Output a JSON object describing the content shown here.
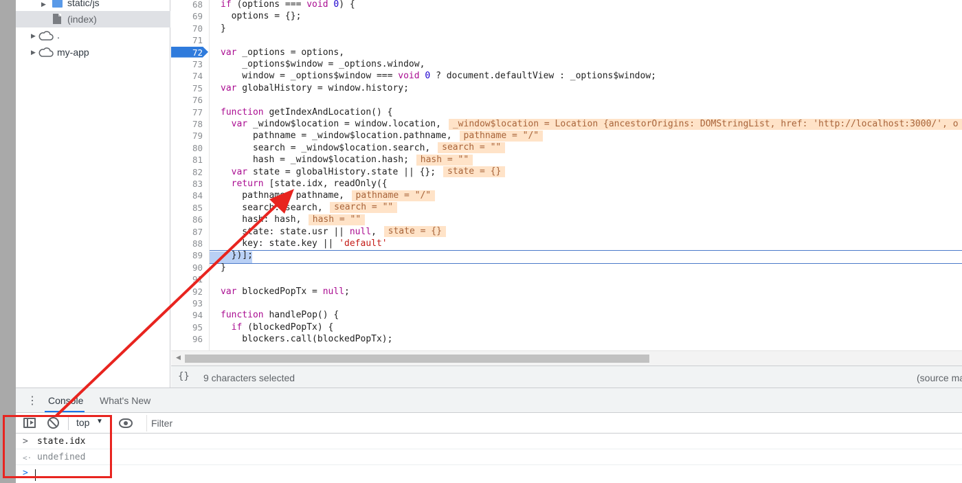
{
  "sidebar": {
    "items": [
      {
        "label": "static/js",
        "type": "folder"
      },
      {
        "label": "(index)",
        "type": "file",
        "selected": true
      },
      {
        "label": ".",
        "type": "cloud"
      },
      {
        "label": "my-app",
        "type": "cloud"
      }
    ]
  },
  "editor": {
    "breakpoint_line": "72",
    "lines": [
      {
        "n": "68",
        "code": "  if (options === void 0) {"
      },
      {
        "n": "69",
        "code": "    options = {};"
      },
      {
        "n": "70",
        "code": "  }"
      },
      {
        "n": "71",
        "code": ""
      },
      {
        "n": "72",
        "code": "  var _options = options,"
      },
      {
        "n": "73",
        "code": "      _options$window = _options.window,"
      },
      {
        "n": "74",
        "code": "      window = _options$window === void 0 ? document.defaultView : _options$window;"
      },
      {
        "n": "75",
        "code": "  var globalHistory = window.history;"
      },
      {
        "n": "76",
        "code": ""
      },
      {
        "n": "77",
        "code": "  function getIndexAndLocation() {"
      },
      {
        "n": "78",
        "code": "    var _window$location = window.location,",
        "value": "_window$location = Location {ancestorOrigins: DOMStringList, href: 'http://localhost:3000/', o"
      },
      {
        "n": "79",
        "code": "        pathname = _window$location.pathname,",
        "value": "pathname = \"/\""
      },
      {
        "n": "80",
        "code": "        search = _window$location.search,",
        "value": "search = \"\""
      },
      {
        "n": "81",
        "code": "        hash = _window$location.hash;",
        "value": "hash = \"\""
      },
      {
        "n": "82",
        "code": "    var state = globalHistory.state || {};",
        "value": "state = {}"
      },
      {
        "n": "83",
        "code": "    return [state.idx, readOnly({"
      },
      {
        "n": "84",
        "code": "      pathname: pathname,",
        "value": "pathname = \"/\""
      },
      {
        "n": "85",
        "code": "      search: search,",
        "value": "search = \"\""
      },
      {
        "n": "86",
        "code": "      hash: hash,",
        "value": "hash = \"\""
      },
      {
        "n": "87",
        "code": "      state: state.usr || null,",
        "value": "state = {}"
      },
      {
        "n": "88",
        "code": "      key: state.key || 'default'"
      },
      {
        "n": "89",
        "code": "    })];"
      },
      {
        "n": "90",
        "code": "  }"
      },
      {
        "n": "91",
        "code": ""
      },
      {
        "n": "92",
        "code": "  var blockedPopTx = null;"
      },
      {
        "n": "93",
        "code": ""
      },
      {
        "n": "94",
        "code": "  function handlePop() {"
      },
      {
        "n": "95",
        "code": "    if (blockedPopTx) {"
      },
      {
        "n": "96",
        "code": "      blockers.call(blockedPopTx);"
      }
    ]
  },
  "statusbar": {
    "format_label": "{}",
    "selection": "9 characters selected",
    "source_map": "(source ma"
  },
  "drawer": {
    "tabs": [
      "Console",
      "What's New"
    ],
    "active_tab": "Console"
  },
  "console_toolbar": {
    "context": "top",
    "filter_placeholder": "Filter"
  },
  "console": {
    "entries": [
      {
        "prompt": ">",
        "text": "state.idx",
        "kind": "input"
      },
      {
        "prompt": "<·",
        "text": "undefined",
        "kind": "result"
      }
    ],
    "input_prompt": ">"
  },
  "colors": {
    "breakpoint": "#2f7bdc",
    "annotation_red": "#e8241f",
    "inline_value_bg": "#ffe3c8",
    "keyword": "#aa0d91",
    "string": "#c41a16"
  }
}
